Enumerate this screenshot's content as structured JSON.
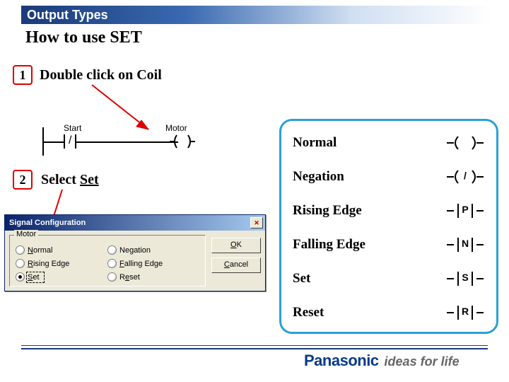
{
  "header": {
    "band": "Output Types",
    "title": "How to use SET"
  },
  "step1": {
    "num": "1",
    "text": "Double click on Coil"
  },
  "step2": {
    "num": "2",
    "prefix": "Select ",
    "set": "Set"
  },
  "ladder": {
    "contact_label": "Start",
    "coil_label": "Motor"
  },
  "dialog": {
    "title": "Signal Configuration",
    "group": "Motor",
    "radios": {
      "normal": "Normal",
      "negation": "Negation",
      "rising": "Rising Edge",
      "falling": "Falling Edge",
      "set": "Set",
      "reset": "Reset"
    },
    "ok": "OK",
    "cancel": "Cancel"
  },
  "legend": {
    "rows": {
      "normal": {
        "label": "Normal",
        "char": ""
      },
      "negation": {
        "label": "Negation",
        "char": "/"
      },
      "rising": {
        "label": "Rising Edge",
        "char": "P"
      },
      "falling": {
        "label": "Falling Edge",
        "char": "N"
      },
      "set": {
        "label": "Set",
        "char": "S"
      },
      "reset": {
        "label": "Reset",
        "char": "R"
      }
    }
  },
  "brand": {
    "name": "Panasonic",
    "tagline": "ideas for life"
  }
}
